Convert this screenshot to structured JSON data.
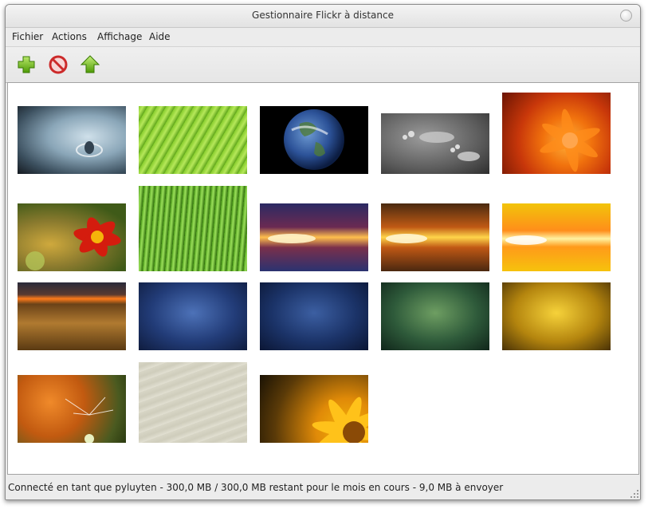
{
  "window": {
    "title": "Gestionnaire Flickr à distance"
  },
  "menu": [
    "Fichier",
    "Actions",
    "Affichage",
    "Aide"
  ],
  "toolbar": {
    "add_icon": "add-plus-icon",
    "remove_icon": "remove-circle-icon",
    "upload_icon": "upload-arrow-icon"
  },
  "gallery": {
    "photos": [
      {
        "name": "water-drop"
      },
      {
        "name": "green-leaf"
      },
      {
        "name": "earth"
      },
      {
        "name": "water-footprint"
      },
      {
        "name": "orange-flower"
      },
      {
        "name": "red-marigold"
      },
      {
        "name": "grass"
      },
      {
        "name": "blue-light-flare"
      },
      {
        "name": "orange-light-flare"
      },
      {
        "name": "yellow-light-flare"
      },
      {
        "name": "desert-sunset"
      },
      {
        "name": "blue-texture"
      },
      {
        "name": "blue-texture-dark"
      },
      {
        "name": "green-texture"
      },
      {
        "name": "gold-texture"
      },
      {
        "name": "dandelion"
      },
      {
        "name": "wood-planks"
      },
      {
        "name": "yellow-daisy"
      }
    ]
  },
  "status": {
    "text": "Connecté en tant que pyluyten - 300,0 MB / 300,0 MB restant pour le mois en cours - 9,0 MB à envoyer"
  }
}
